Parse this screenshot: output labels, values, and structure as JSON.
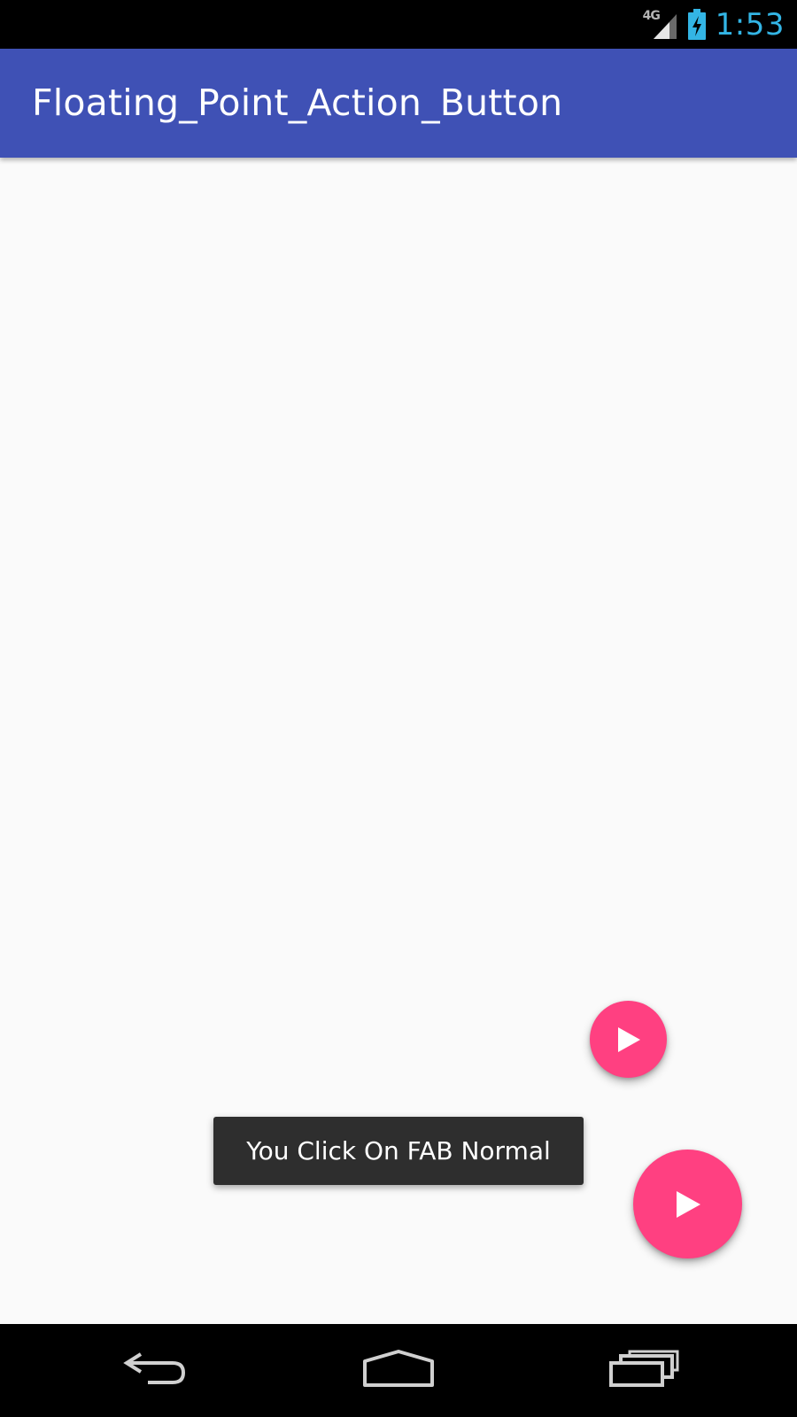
{
  "status_bar": {
    "network": "4G",
    "time": "1:53",
    "icons": [
      "signal-icon",
      "battery-charging-icon"
    ]
  },
  "app_bar": {
    "title": "Floating_Point_Action_Button"
  },
  "fabs": {
    "mini": {
      "icon": "play-icon"
    },
    "normal": {
      "icon": "play-icon"
    }
  },
  "toast": {
    "message": "You Click On FAB Normal"
  },
  "nav_bar": {
    "icons": [
      "back-icon",
      "home-icon",
      "recents-icon"
    ]
  },
  "colors": {
    "primary": "#3f51b5",
    "accent": "#ff4081",
    "clock": "#33b5e5",
    "background": "#fafafa",
    "toast": "#2e2e2e"
  }
}
